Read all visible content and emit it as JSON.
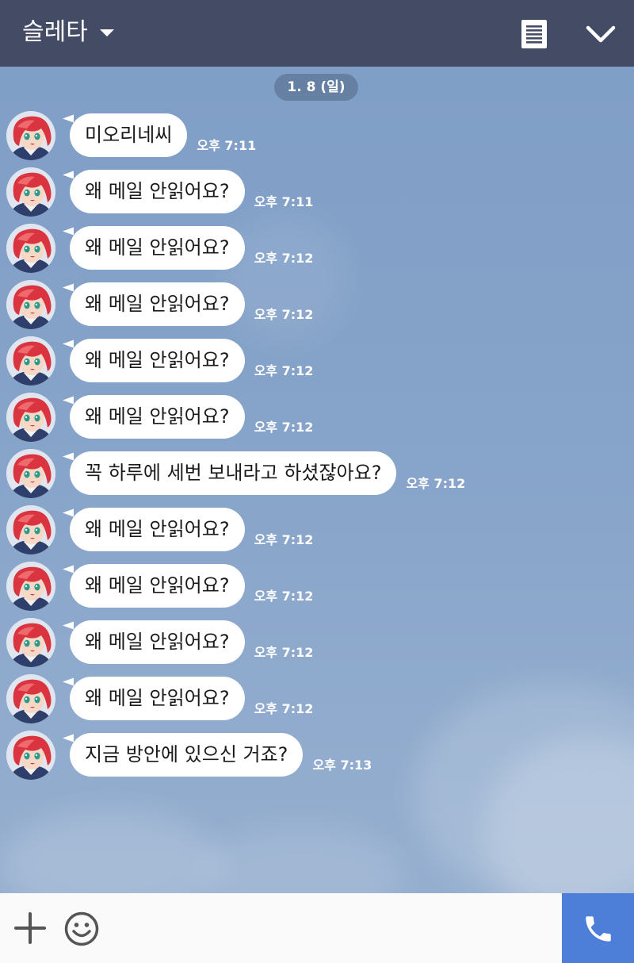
{
  "header": {
    "title": "슬레타",
    "icons": [
      "chevron-down-icon",
      "memo-icon",
      "collapse-icon"
    ]
  },
  "date_pill": "1. 8 (일)",
  "messages": [
    {
      "text": "미오리네씨",
      "time": "오후 7:11"
    },
    {
      "text": "왜 메일 안읽어요?",
      "time": "오후 7:11"
    },
    {
      "text": "왜 메일 안읽어요?",
      "time": "오후 7:12"
    },
    {
      "text": "왜 메일 안읽어요?",
      "time": "오후 7:12"
    },
    {
      "text": "왜 메일 안읽어요?",
      "time": "오후 7:12"
    },
    {
      "text": "왜 메일 안읽어요?",
      "time": "오후 7:12"
    },
    {
      "text": "꼭  하루에 세번 보내라고 하셨잖아요?",
      "time": "오후 7:12"
    },
    {
      "text": "왜 메일 안읽어요?",
      "time": "오후 7:12"
    },
    {
      "text": "왜 메일 안읽어요?",
      "time": "오후 7:12"
    },
    {
      "text": "왜 메일 안읽어요?",
      "time": "오후 7:12"
    },
    {
      "text": "왜 메일 안읽어요?",
      "time": "오후 7:12"
    },
    {
      "text": "지금 방안에 있으신 거죠?",
      "time": "오후 7:13"
    }
  ],
  "input_bar": {
    "placeholder": "",
    "icons": [
      "plus-icon",
      "emoji-icon",
      "phone-icon"
    ]
  },
  "colors": {
    "header_bg": "#434c64",
    "call_button": "#4e7fd8",
    "bubble": "#ffffff",
    "background": "#86a3c9"
  }
}
